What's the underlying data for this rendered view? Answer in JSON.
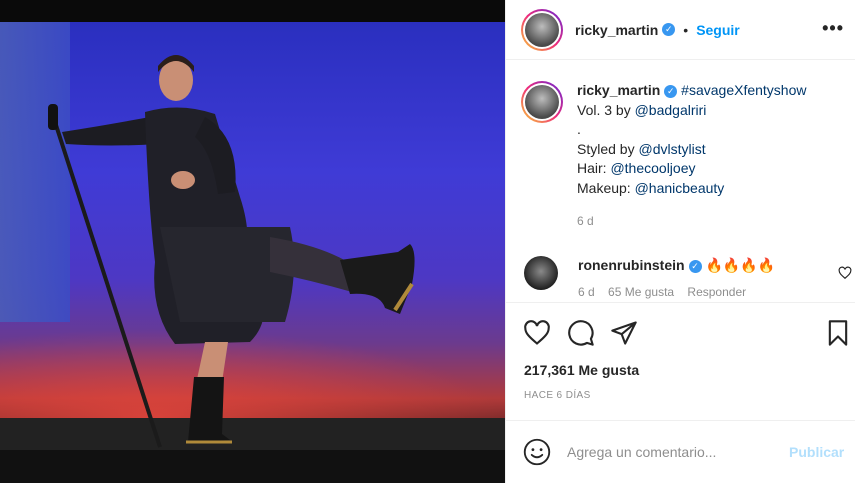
{
  "post": {
    "username": "ricky_martin",
    "verified_glyph": "✓",
    "separator": "•",
    "follow_label": "Seguir",
    "more_label": "•••",
    "caption": {
      "username": "ricky_martin",
      "hashtag": "#savageXfentyshow",
      "line1_rest": "Vol. 3 by ",
      "mention_badgalriri": "@badgalriri",
      "dot_line": ".",
      "styled_by": "Styled by ",
      "mention_stylist": "@dvlstylist",
      "hair": "Hair: ",
      "mention_hair": "@thecooljoey",
      "makeup": "Makeup: ",
      "mention_makeup": "@hanicbeauty",
      "time": "6 d"
    },
    "comment": {
      "username": "ronenrubinstein",
      "text": "🔥🔥🔥🔥",
      "time": "6 d",
      "likes": "65 Me gusta",
      "reply": "Responder"
    },
    "likes_count": "217,361 Me gusta",
    "posted_ago": "HACE 6 DÍAS",
    "comment_input": {
      "placeholder": "Agrega un comentario..."
    },
    "publish_label": "Publicar"
  },
  "icons": [
    "heart-icon",
    "comment-icon",
    "share-icon",
    "bookmark-icon",
    "emoji-icon",
    "more-icon",
    "verified-icon"
  ],
  "colors": {
    "link": "#00376b",
    "follow": "#0095f6",
    "verified": "#3897f0",
    "publish_disabled": "#b2dffc"
  }
}
